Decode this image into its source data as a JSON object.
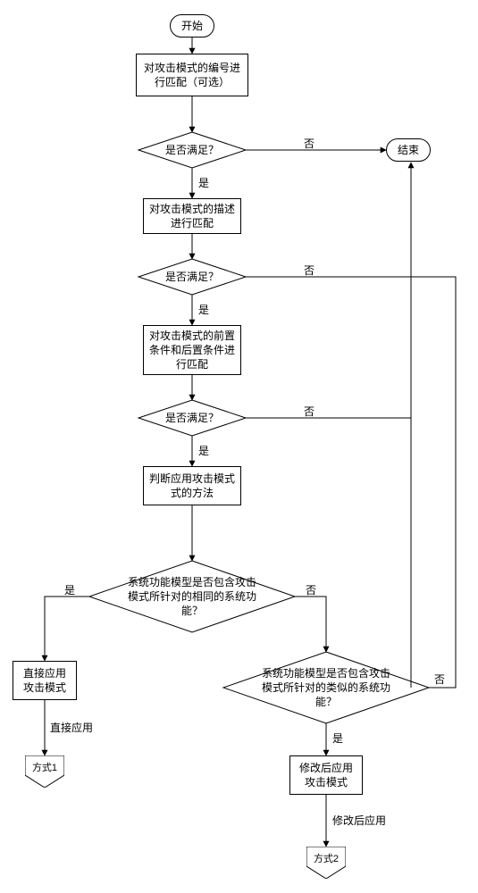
{
  "chart_data": {
    "type": "flowchart",
    "nodes": [
      {
        "id": "start",
        "type": "terminator",
        "label": "开始"
      },
      {
        "id": "p1",
        "type": "process",
        "label": "对攻击模式的编号\n进行匹配（可选）"
      },
      {
        "id": "d1",
        "type": "decision",
        "label": "是否满足？"
      },
      {
        "id": "p2",
        "type": "process",
        "label": "对攻击模式的\n描述进行匹配"
      },
      {
        "id": "d2",
        "type": "decision",
        "label": "是否满足？"
      },
      {
        "id": "p3",
        "type": "process",
        "label": "对攻击模式的前\n置条件和后置条\n件进行匹配"
      },
      {
        "id": "d3",
        "type": "decision",
        "label": "是否满足？"
      },
      {
        "id": "p4",
        "type": "process",
        "label": "判断应用攻击模\n式的方法"
      },
      {
        "id": "d4",
        "type": "decision",
        "label": "系统功能模型是否包含攻\n击模式所针对的相同的系\n统功能？"
      },
      {
        "id": "p5",
        "type": "process",
        "label": "直接应用\n攻击模式"
      },
      {
        "id": "d5",
        "type": "decision",
        "label": "系统功能模型是否包含攻\n击模式所针对的类似的系\n统功能？"
      },
      {
        "id": "p6",
        "type": "process",
        "label": "修改后应用\n攻击模式"
      },
      {
        "id": "end",
        "type": "terminator",
        "label": "结束"
      },
      {
        "id": "m1",
        "type": "offpage",
        "label": "方式1"
      },
      {
        "id": "m2",
        "type": "offpage",
        "label": "方式2"
      }
    ],
    "edges": [
      {
        "from": "start",
        "to": "p1"
      },
      {
        "from": "p1",
        "to": "d1"
      },
      {
        "from": "d1",
        "to": "p2",
        "label": "是"
      },
      {
        "from": "d1",
        "to": "end",
        "label": "否"
      },
      {
        "from": "p2",
        "to": "d2"
      },
      {
        "from": "d2",
        "to": "p3",
        "label": "是"
      },
      {
        "from": "d2",
        "to": "end",
        "label": "否"
      },
      {
        "from": "p3",
        "to": "d3"
      },
      {
        "from": "d3",
        "to": "p4",
        "label": "是"
      },
      {
        "from": "d3",
        "to": "end",
        "label": "否"
      },
      {
        "from": "p4",
        "to": "d4"
      },
      {
        "from": "d4",
        "to": "p5",
        "label": "是"
      },
      {
        "from": "d4",
        "to": "d5",
        "label": "否"
      },
      {
        "from": "p5",
        "to": "m1",
        "label": "直接应用"
      },
      {
        "from": "d5",
        "to": "p6",
        "label": "是"
      },
      {
        "from": "d5",
        "to": "end",
        "label": "否"
      },
      {
        "from": "p6",
        "to": "m2",
        "label": "修改后应用"
      }
    ]
  },
  "labels": {
    "start": "开始",
    "p1": "对攻击模式的编号进行匹配（可选）",
    "d1": "是否满足？",
    "p2": "对攻击模式的描述进行匹配",
    "d2": "是否满足？",
    "p3": "对攻击模式的前置条件和后置条件进行匹配",
    "d3": "是否满足？",
    "p4": "判断应用攻击模式式的方法",
    "d4": "系统功能模型是否包含攻击模式所针对的相同的系统功能？",
    "p5": "直接应用攻击模式",
    "d5": "系统功能模型是否包含攻击模式所针对的类似的系统功能？",
    "p6": "修改后应用\n攻击模式",
    "end": "结束",
    "m1": "方式1",
    "m2": "方式2",
    "yes": "是",
    "no": "否",
    "direct": "直接应用",
    "modified": "修改后应用"
  }
}
